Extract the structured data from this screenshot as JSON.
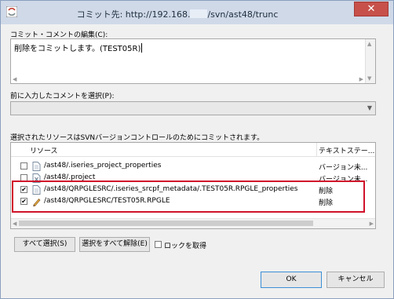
{
  "window": {
    "title_prefix": "コミット先: http://192.168.",
    "title_suffix": "/svn/ast48/trunc",
    "close_label": "✕"
  },
  "comment": {
    "label": "コミット・コメントの編集(C):",
    "value": "削除をコミットします。(TEST05R)"
  },
  "previous": {
    "label": "前に入力したコメントを選択(P):",
    "value": ""
  },
  "resources": {
    "label": "選択されたリソースはSVNバージョンコントロールのためにコミットされます。",
    "headers": [
      "リソース",
      "テキストステー..."
    ],
    "rows": [
      {
        "checked": false,
        "path": "/ast48/.iseries_project_properties",
        "status": "バージョン未..."
      },
      {
        "checked": false,
        "path": "/ast48/.project",
        "status": "バージョン未..."
      },
      {
        "checked": true,
        "path": "/ast48/QRPGLESRC/.iseries_srcpf_metadata/.TEST05R.RPGLE_properties",
        "status": "削除"
      },
      {
        "checked": true,
        "path": "/ast48/QRPGLESRC/TEST05R.RPGLE",
        "status": "削除"
      }
    ]
  },
  "buttons": {
    "select_all": "すべて選択(S)",
    "deselect_all": "選択をすべて解除(E)",
    "lock_label": "ロックを取得",
    "ok": "OK",
    "cancel": "キャンセル"
  },
  "colors": {
    "highlight": "#d0122a",
    "titlebar": "#cfd9e8"
  }
}
